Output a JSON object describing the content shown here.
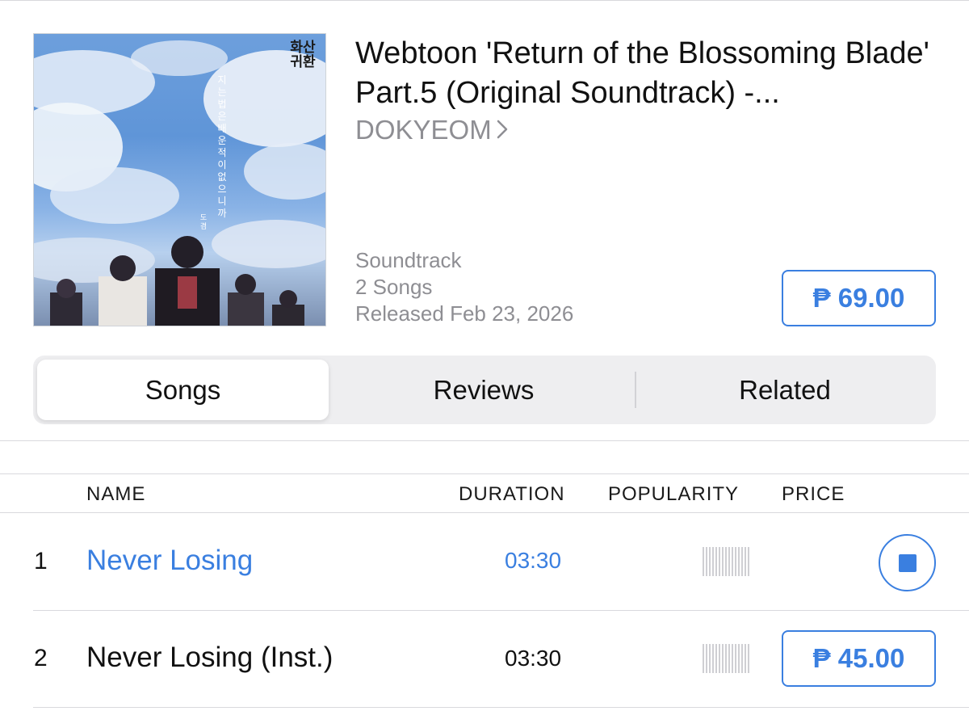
{
  "album": {
    "title": "Webtoon 'Return of the Blossoming Blade' Part.5 (Original Soundtrack) -...",
    "artist": "DOKYEOM",
    "genre": "Soundtrack",
    "song_count": "2 Songs",
    "released": "Released Feb 23, 2026",
    "price": "₱ 69.00",
    "cover": {
      "logo_text": "화산귀환",
      "vertical_text": "지는법은배운적이없으니까",
      "artist_text": "도겸"
    }
  },
  "tabs": {
    "songs": "Songs",
    "reviews": "Reviews",
    "related": "Related",
    "selected": "Songs"
  },
  "table": {
    "headers": {
      "name": "NAME",
      "duration": "DURATION",
      "popularity": "POPULARITY",
      "price": "PRICE"
    },
    "rows": [
      {
        "number": "1",
        "name": "Never Losing",
        "duration": "03:30",
        "state": "playing"
      },
      {
        "number": "2",
        "name": "Never Losing (Inst.)",
        "duration": "03:30",
        "price": "₱ 45.00"
      }
    ]
  },
  "colors": {
    "accent": "#3a7fe0",
    "secondary_text": "#8e8e93",
    "primary_text": "#111111"
  },
  "icons": {
    "artist_chevron": "chevron-right-icon",
    "stop": "stop-icon",
    "popularity": "popularity-bars-icon"
  }
}
